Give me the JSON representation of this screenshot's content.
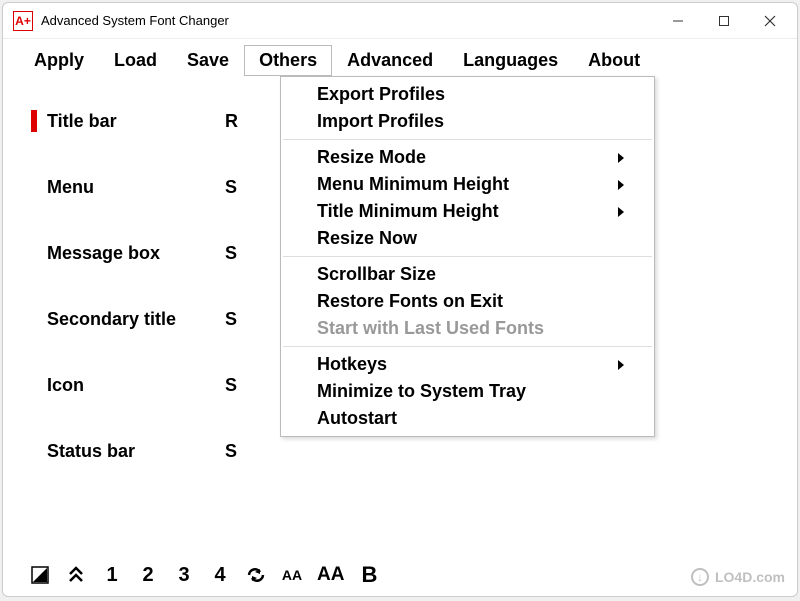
{
  "app": {
    "icon_text": "A+",
    "title": "Advanced System Font Changer"
  },
  "menubar": {
    "items": [
      {
        "label": "Apply"
      },
      {
        "label": "Load"
      },
      {
        "label": "Save"
      },
      {
        "label": "Others"
      },
      {
        "label": "Advanced"
      },
      {
        "label": "Languages"
      },
      {
        "label": "About"
      }
    ],
    "active_index": 3
  },
  "rows": [
    {
      "label": "Title bar",
      "value": "R",
      "selected": true
    },
    {
      "label": "Menu",
      "value": "S",
      "selected": false
    },
    {
      "label": "Message box",
      "value": "S",
      "selected": false
    },
    {
      "label": "Secondary title",
      "value": "S",
      "selected": false
    },
    {
      "label": "Icon",
      "value": "S",
      "selected": false
    },
    {
      "label": "Status bar",
      "value": "S",
      "selected": false
    }
  ],
  "dropdown": {
    "groups": [
      [
        {
          "label": "Export Profiles",
          "submenu": false,
          "disabled": false
        },
        {
          "label": "Import Profiles",
          "submenu": false,
          "disabled": false
        }
      ],
      [
        {
          "label": "Resize Mode",
          "submenu": true,
          "disabled": false
        },
        {
          "label": "Menu Minimum Height",
          "submenu": true,
          "disabled": false
        },
        {
          "label": "Title Minimum Height",
          "submenu": true,
          "disabled": false
        },
        {
          "label": "Resize Now",
          "submenu": false,
          "disabled": false
        }
      ],
      [
        {
          "label": "Scrollbar Size",
          "submenu": false,
          "disabled": false
        },
        {
          "label": "Restore Fonts on Exit",
          "submenu": false,
          "disabled": false
        },
        {
          "label": "Start with Last Used Fonts",
          "submenu": false,
          "disabled": true
        }
      ],
      [
        {
          "label": "Hotkeys",
          "submenu": true,
          "disabled": false
        },
        {
          "label": "Minimize to System Tray",
          "submenu": false,
          "disabled": false
        },
        {
          "label": "Autostart",
          "submenu": false,
          "disabled": false
        }
      ]
    ]
  },
  "toolbar": {
    "numbers": [
      "1",
      "2",
      "3",
      "4"
    ],
    "aa_small": "AA",
    "aa_large": "AA",
    "bold": "B"
  },
  "watermark": {
    "icon": "↓",
    "text": "LO4D.com"
  }
}
